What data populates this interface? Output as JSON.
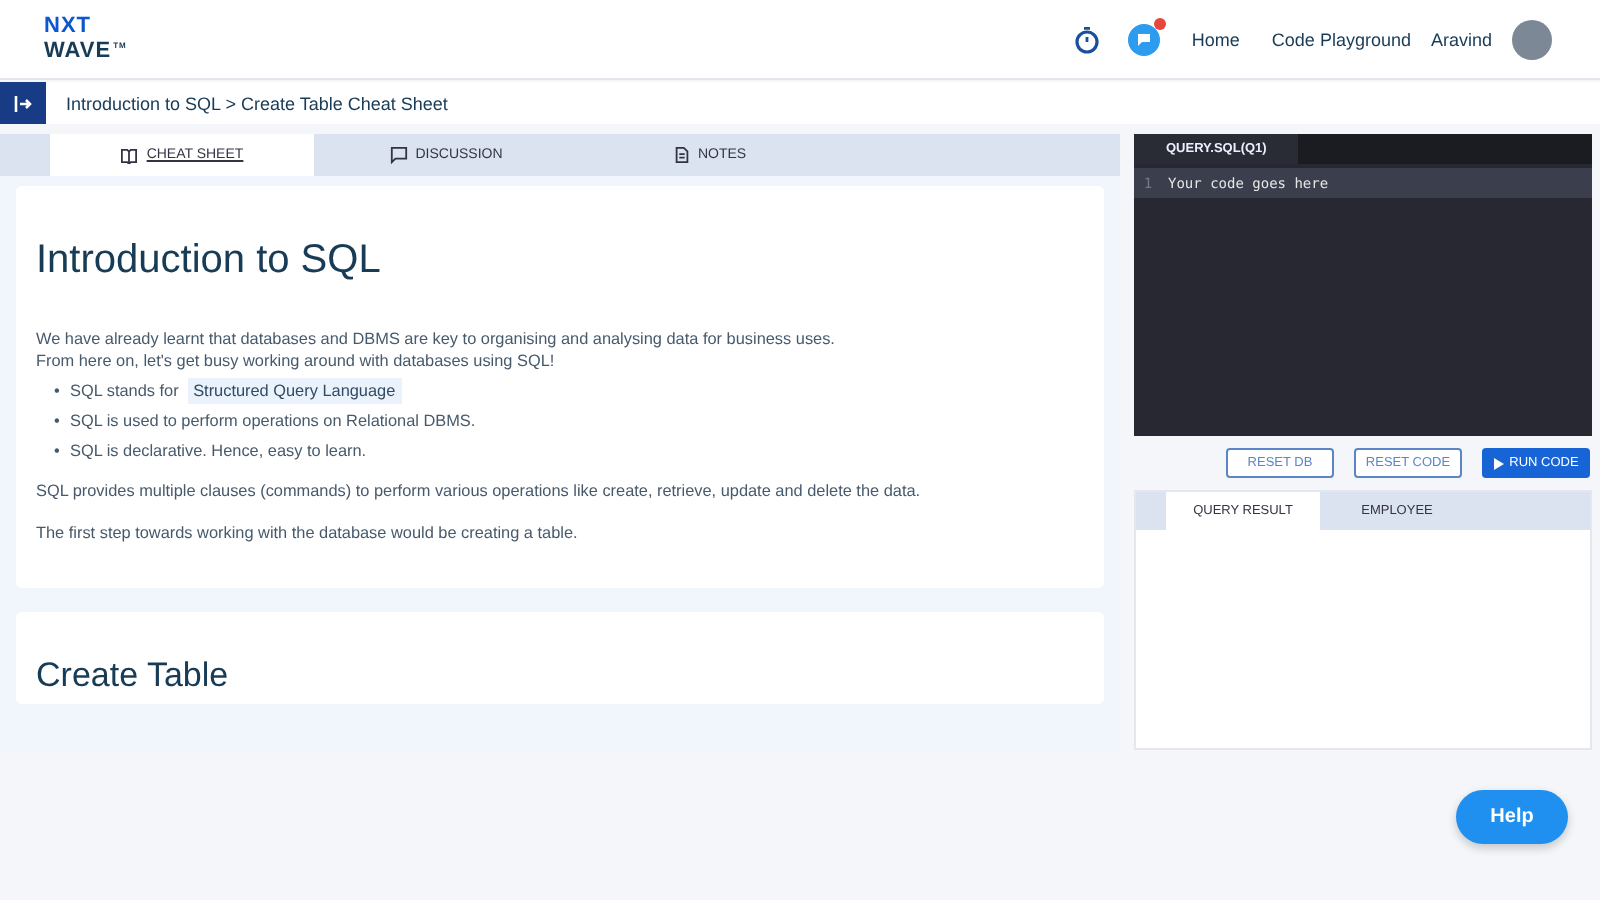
{
  "header": {
    "logo": {
      "line1": "NXT",
      "line2": "WAVE",
      "mark": "TM"
    },
    "notification": true,
    "nav": [
      "Home",
      "Code Playground"
    ],
    "user": "Aravind"
  },
  "breadcrumb": "Introduction to SQL > Create Table Cheat Sheet",
  "tabs": [
    {
      "label": "CHEAT SHEET",
      "kind": "book",
      "selected": true
    },
    {
      "label": "DISCUSSION",
      "kind": "chat",
      "selected": false
    },
    {
      "label": "NOTES",
      "kind": "notes",
      "selected": false
    }
  ],
  "article": {
    "title": "Introduction to SQL",
    "intro": [
      "We have already learnt that databases and DBMS are key to organising and analysing data for business uses.",
      "From here on, let's get busy working around with databases using SQL!"
    ],
    "bullets": [
      {
        "marker": "•",
        "text": "SQL stands for",
        "code": "Structured Query Language"
      },
      {
        "marker": "•",
        "text": "SQL is used to perform operations on Relational DBMS."
      },
      {
        "marker": "•",
        "text": "SQL is declarative. Hence, easy to learn."
      }
    ],
    "paragraphs": [
      "SQL provides multiple clauses (commands) to perform various operations like create, retrieve, update and delete the data.",
      "The first step towards working with the database would be creating a table."
    ]
  },
  "next_section": {
    "title": "Create Table"
  },
  "editor": {
    "file_tab": "QUERY.SQL(Q1)",
    "lines": [
      {
        "number": "1",
        "code": "Your code goes here"
      }
    ]
  },
  "actions": [
    {
      "label": "RESET DB",
      "kind": "outline"
    },
    {
      "label": "RESET CODE",
      "kind": "outline"
    },
    {
      "label": "RUN CODE",
      "kind": "primary"
    }
  ],
  "result_tabs": [
    {
      "label": "QUERY RESULT",
      "selected": true
    },
    {
      "label": "EMPLOYEE",
      "selected": false
    }
  ],
  "help": "Help"
}
